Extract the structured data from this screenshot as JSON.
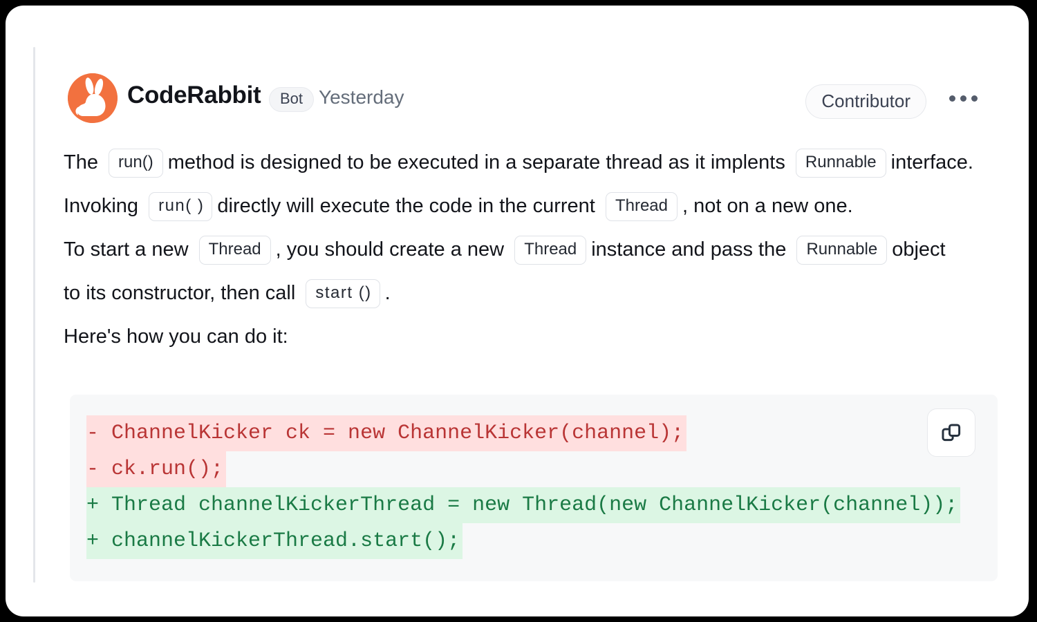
{
  "comment": {
    "author": "CodeRabbit",
    "bot_badge": "Bot",
    "timestamp": "Yesterday",
    "role_badge": "Contributor",
    "avatar_icon": "rabbit-avatar-icon",
    "menu_icon": "kebab-menu-icon",
    "accent_color": "#f2713f"
  },
  "body": {
    "line1": {
      "a": "The",
      "code1": "run()",
      "b": "method is designed to be executed in a separate thread as it implents",
      "code2": "Runnable",
      "c": "interface."
    },
    "line2": {
      "a": "Invoking",
      "code1": "run( )",
      "b": "directly will execute the code in the current",
      "code2": "Thread",
      "c": ", not on a new one."
    },
    "line3": {
      "a": "To start a new",
      "code1": "Thread",
      "b": ", you should create a new",
      "code2": "Thread",
      "c": "instance and pass the",
      "code3": "Runnable",
      "d": "object"
    },
    "line4": {
      "a": "to its constructor, then call",
      "code1": "start ()",
      "b": "."
    },
    "line5": "Here's how you can do it:"
  },
  "code_block": {
    "copy_button_icon": "copy-icon",
    "lines": [
      {
        "type": "del",
        "text": "- ChannelKicker ck = new ChannelKicker(channel);"
      },
      {
        "type": "del",
        "text": "- ck.run();"
      },
      {
        "type": "add",
        "text": "+ Thread channelKickerThread = new Thread(new ChannelKicker(channel));"
      },
      {
        "type": "add",
        "text": "+ channelKickerThread.start();"
      }
    ],
    "colors": {
      "deletion_bg": "#ffdfdf",
      "deletion_fg": "#b93535",
      "addition_bg": "#dcf6e4",
      "addition_fg": "#1a7a45",
      "block_bg": "#f7f8f9"
    }
  }
}
